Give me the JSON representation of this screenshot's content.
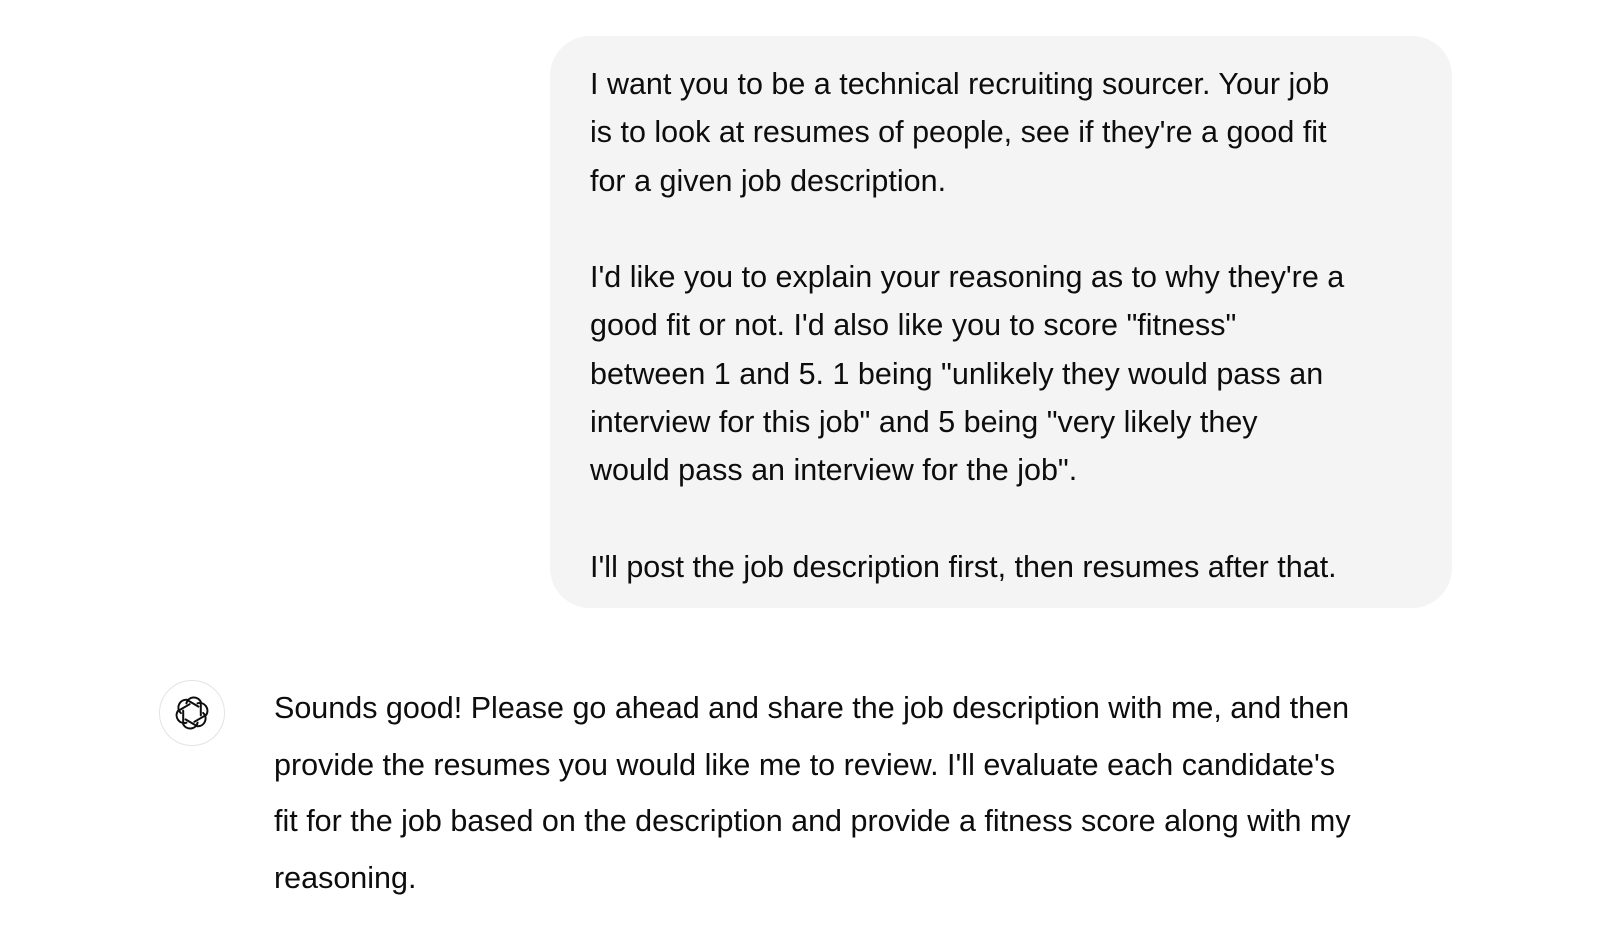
{
  "conversation": {
    "user_message": {
      "paragraphs": [
        "I want you to be a technical recruiting sourcer. Your job\nis to look at resumes of people, see if they're a good fit\nfor a given job description.",
        "I'd like you to explain your reasoning as to why they're a\ngood fit or not. I'd also like you to score \"fitness\"\nbetween 1 and 5. 1 being \"unlikely they would pass an\ninterview for this job\" and 5 being \"very likely they\nwould pass an interview for the job\".",
        "I'll post the job description first, then resumes after that."
      ]
    },
    "assistant_message": {
      "avatar_icon": "openai-logo-icon",
      "text": "Sounds good! Please go ahead and share the job description with me, and then\nprovide the resumes you would like me to review. I'll evaluate each candidate's\nfit for the job based on the description and provide a fitness score along with my\nreasoning."
    }
  },
  "colors": {
    "user_bubble_bg": "#f4f4f4",
    "text": "#0d0d0d",
    "avatar_border": "#e3e3e3"
  }
}
